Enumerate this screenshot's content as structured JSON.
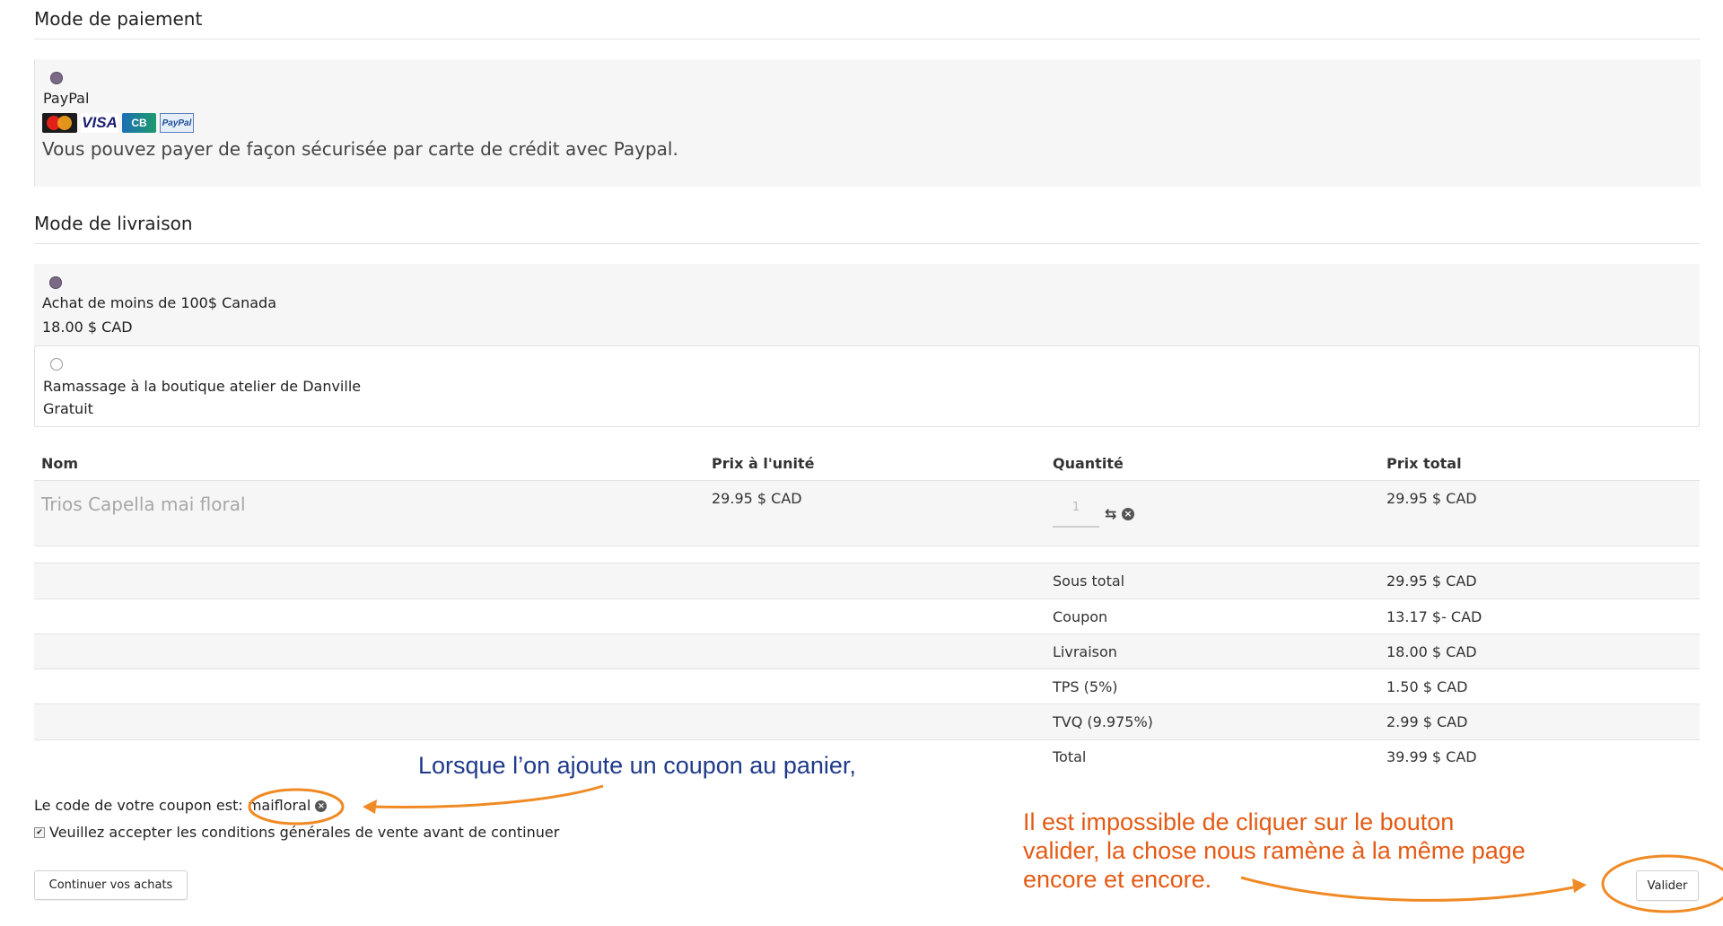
{
  "payment": {
    "title": "Mode de paiement",
    "option_label": "PayPal",
    "description": "Vous pouvez payer de façon sécurisée par carte de crédit avec Paypal.",
    "cards": [
      "MasterCard",
      "VISA",
      "CB",
      "PayPal"
    ]
  },
  "shipping": {
    "title": "Mode de livraison",
    "options": [
      {
        "label": "Achat de moins de 100$ Canada",
        "price": "18.00 $ CAD",
        "selected": true
      },
      {
        "label": "Ramassage à la boutique atelier de Danville",
        "price": "Gratuit",
        "selected": false
      }
    ]
  },
  "cart": {
    "headers": {
      "name": "Nom",
      "unit_price": "Prix à l'unité",
      "quantity": "Quantité",
      "total": "Prix total"
    },
    "item": {
      "name": "Trios Capella mai floral",
      "unit_price": "29.95 $ CAD",
      "quantity": "1",
      "total": "29.95 $ CAD"
    },
    "summary": [
      {
        "label": "Sous total",
        "value": "29.95 $ CAD"
      },
      {
        "label": "Coupon",
        "value": "13.17 $- CAD"
      },
      {
        "label": "Livraison",
        "value": "18.00 $ CAD"
      },
      {
        "label": "TPS (5%)",
        "value": "1.50 $ CAD"
      },
      {
        "label": "TVQ (9.975%)",
        "value": "2.99 $ CAD"
      },
      {
        "label": "Total",
        "value": "39.99 $ CAD"
      }
    ]
  },
  "coupon": {
    "prefix": "Le code de votre coupon est:",
    "code": "maifloral"
  },
  "terms": {
    "label": "Veuillez accepter les conditions générales de vente avant de continuer",
    "checked": true
  },
  "buttons": {
    "continue": "Continuer vos achats",
    "validate": "Valider"
  },
  "annotations": {
    "coupon_note": "Lorsque l’on ajoute un coupon au panier,",
    "validate_note_lines": [
      "Il est impossible de cliquer sur le bouton",
      "valider, la chose nous ramène à la même page",
      "encore et encore."
    ],
    "colors": {
      "blue": "#1f3a8a",
      "orange": "#f08a24",
      "orange_text": "#e35b15"
    }
  }
}
